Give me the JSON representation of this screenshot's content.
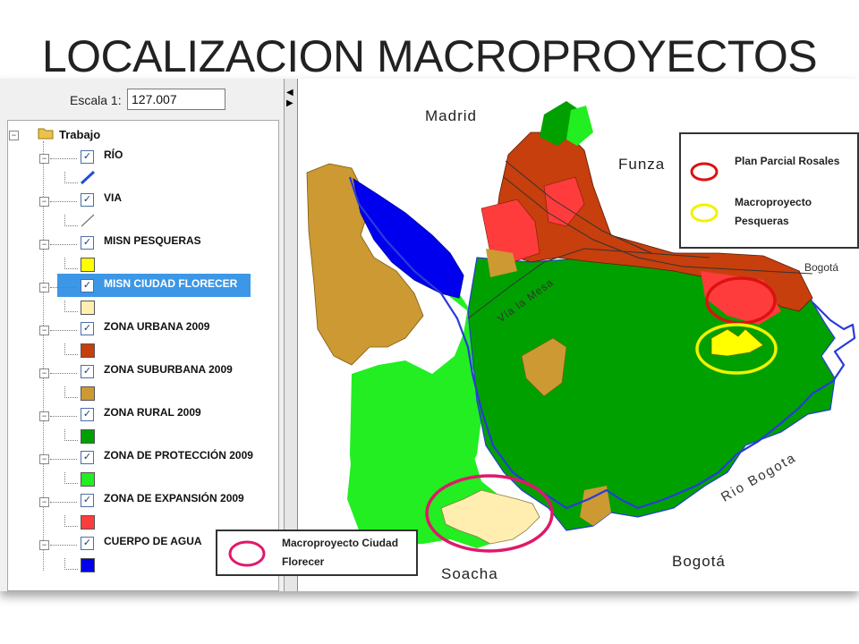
{
  "title": "LOCALIZACION MACROPROYECTOS",
  "panel": {
    "scale_label": "Escala 1:",
    "scale_value": "127.007",
    "root_label": "Trabajo",
    "layers": [
      {
        "label": "RÍO",
        "symbol": "line",
        "color": "#1f4fd8"
      },
      {
        "label": "VIA",
        "symbol": "line",
        "color": "#777777"
      },
      {
        "label": "MISN PESQUERAS",
        "symbol": "fill",
        "color": "#ffff00"
      },
      {
        "label": "MISN CIUDAD FLORECER",
        "symbol": "fill",
        "color": "#ffeeb0",
        "selected": true
      },
      {
        "label": "ZONA URBANA 2009",
        "symbol": "fill",
        "color": "#c63f0d"
      },
      {
        "label": "ZONA SUBURBANA 2009",
        "symbol": "fill",
        "color": "#cc9933"
      },
      {
        "label": "ZONA RURAL 2009",
        "symbol": "fill",
        "color": "#00a000"
      },
      {
        "label": "ZONA DE PROTECCIÓN 2009",
        "symbol": "fill",
        "color": "#22ee22"
      },
      {
        "label": "ZONA DE EXPANSIÓN 2009",
        "symbol": "fill",
        "color": "#ff3c3c"
      },
      {
        "label": "CUERPO DE AGUA",
        "symbol": "fill",
        "color": "#0000ee"
      }
    ]
  },
  "map": {
    "places": {
      "madrid": "Madrid",
      "funza": "Funza",
      "bogota_small": "Bogotá",
      "soacha": "Soacha",
      "bogota": "Bogotá"
    },
    "road_label": "Vía la Mesa",
    "river_label": "Rio Bogota",
    "legend_top": [
      {
        "label": "Plan Parcial Rosales",
        "ring_color": "#dd1111"
      },
      {
        "label": "Macroproyecto Pesqueras",
        "ring_color": "#f2f200"
      }
    ],
    "legend_bottom": {
      "label": "Macroproyecto Ciudad Florecer",
      "ring_color": "#e0186a"
    }
  }
}
